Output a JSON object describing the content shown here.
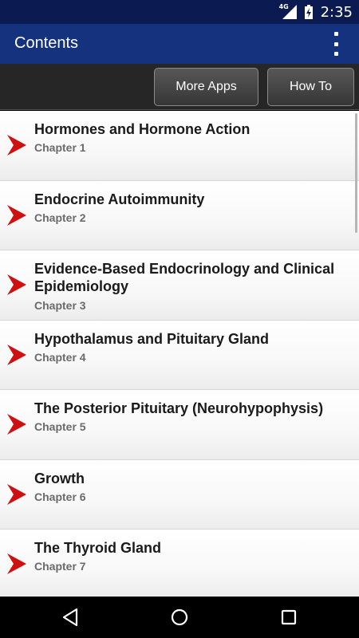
{
  "status": {
    "time": "2:35",
    "network": "4G"
  },
  "app_bar": {
    "title": "Contents"
  },
  "toolbar": {
    "more_apps_label": "More Apps",
    "how_to_label": "How To"
  },
  "chapters": [
    {
      "title": "Hormones and Hormone Action",
      "subtitle": "Chapter 1"
    },
    {
      "title": "Endocrine Autoimmunity",
      "subtitle": "Chapter 2"
    },
    {
      "title": "Evidence-Based Endocrinology and Clinical Epidemiology",
      "subtitle": "Chapter 3"
    },
    {
      "title": "Hypothalamus and Pituitary Gland",
      "subtitle": "Chapter 4"
    },
    {
      "title": "The Posterior Pituitary (Neurohypophysis)",
      "subtitle": "Chapter 5"
    },
    {
      "title": "Growth",
      "subtitle": "Chapter 6"
    },
    {
      "title": "The Thyroid Gland",
      "subtitle": "Chapter 7"
    }
  ],
  "colors": {
    "app_bar": "#14327e",
    "status_bar": "#0c1a52",
    "arrow": "#d01010"
  }
}
